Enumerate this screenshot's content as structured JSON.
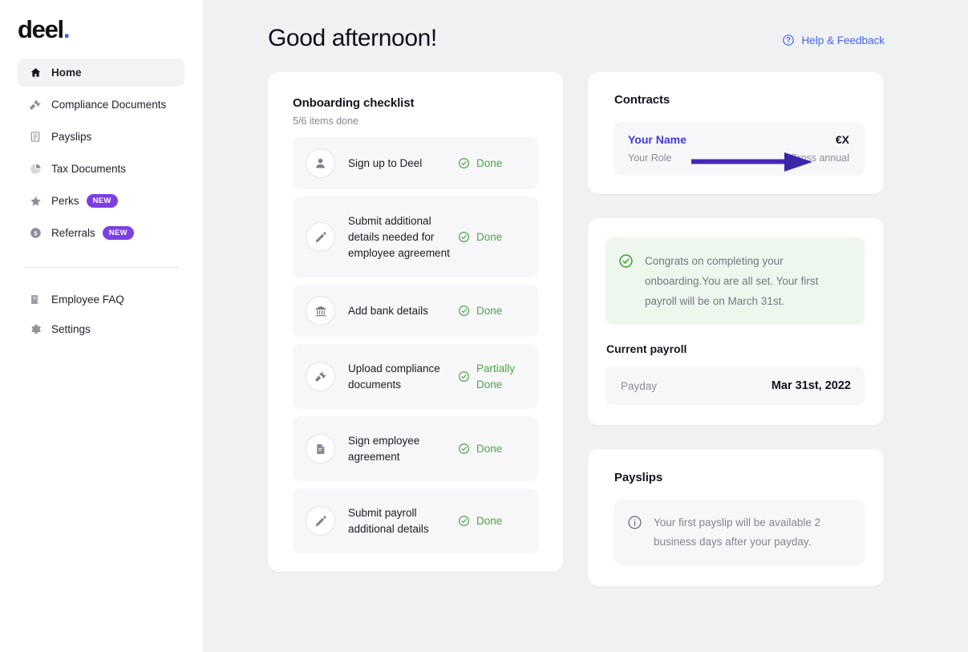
{
  "brand": {
    "logo_text": "deel",
    "logo_dot": ".",
    "accent_blue": "#4257f5",
    "badge_purple": "#7d3fe0",
    "green": "#4ca546",
    "link_blue": "#4766e8",
    "contract_link": "#4039d8",
    "arrow_color": "#4527b5"
  },
  "sidebar": {
    "items": [
      {
        "label": "Home",
        "icon": "home-icon",
        "active": true,
        "badge": null
      },
      {
        "label": "Compliance Documents",
        "icon": "gavel-icon",
        "active": false,
        "badge": null
      },
      {
        "label": "Payslips",
        "icon": "document-icon",
        "active": false,
        "badge": null
      },
      {
        "label": "Tax Documents",
        "icon": "pie-chart-icon",
        "active": false,
        "badge": null
      },
      {
        "label": "Perks",
        "icon": "star-icon",
        "active": false,
        "badge": "NEW"
      },
      {
        "label": "Referrals",
        "icon": "dollar-circle-icon",
        "active": false,
        "badge": "NEW"
      }
    ],
    "bottom_items": [
      {
        "label": "Employee FAQ",
        "icon": "book-icon"
      },
      {
        "label": "Settings",
        "icon": "gear-icon"
      }
    ]
  },
  "header": {
    "greeting": "Good afternoon!",
    "help_label": "Help & Feedback",
    "help_icon": "question-circle-icon"
  },
  "onboarding": {
    "title": "Onboarding checklist",
    "subtitle": "5/6 items done",
    "items": [
      {
        "label": "Sign up to Deel",
        "icon": "person-icon",
        "status": "Done"
      },
      {
        "label": "Submit additional details needed for employee agreement",
        "icon": "pencil-icon",
        "status": "Done"
      },
      {
        "label": "Add bank details",
        "icon": "bank-icon",
        "status": "Done"
      },
      {
        "label": "Upload compliance documents",
        "icon": "gavel-icon",
        "status": "Partially Done"
      },
      {
        "label": "Sign employee agreement",
        "icon": "signed-document-icon",
        "status": "Done"
      },
      {
        "label": "Submit payroll additional details",
        "icon": "pencil-icon",
        "status": "Done"
      }
    ]
  },
  "contracts": {
    "title": "Contracts",
    "name": "Your Name",
    "role": "Your Role",
    "amount": "€X",
    "amount_label": "Gross annual"
  },
  "payroll": {
    "congrats_text": "Congrats on completing your onboarding.You are all set. Your first payroll will be on March 31st.",
    "congrats_icon": "check-circle-icon",
    "section_title": "Current payroll",
    "payday_label": "Payday",
    "payday_value": "Mar 31st, 2022"
  },
  "payslips": {
    "title": "Payslips",
    "info_icon": "info-circle-icon",
    "info_text": "Your first payslip will be available 2 business days after your payday."
  },
  "annotation": {
    "type": "arrow",
    "points_to": "contracts-name-link"
  }
}
